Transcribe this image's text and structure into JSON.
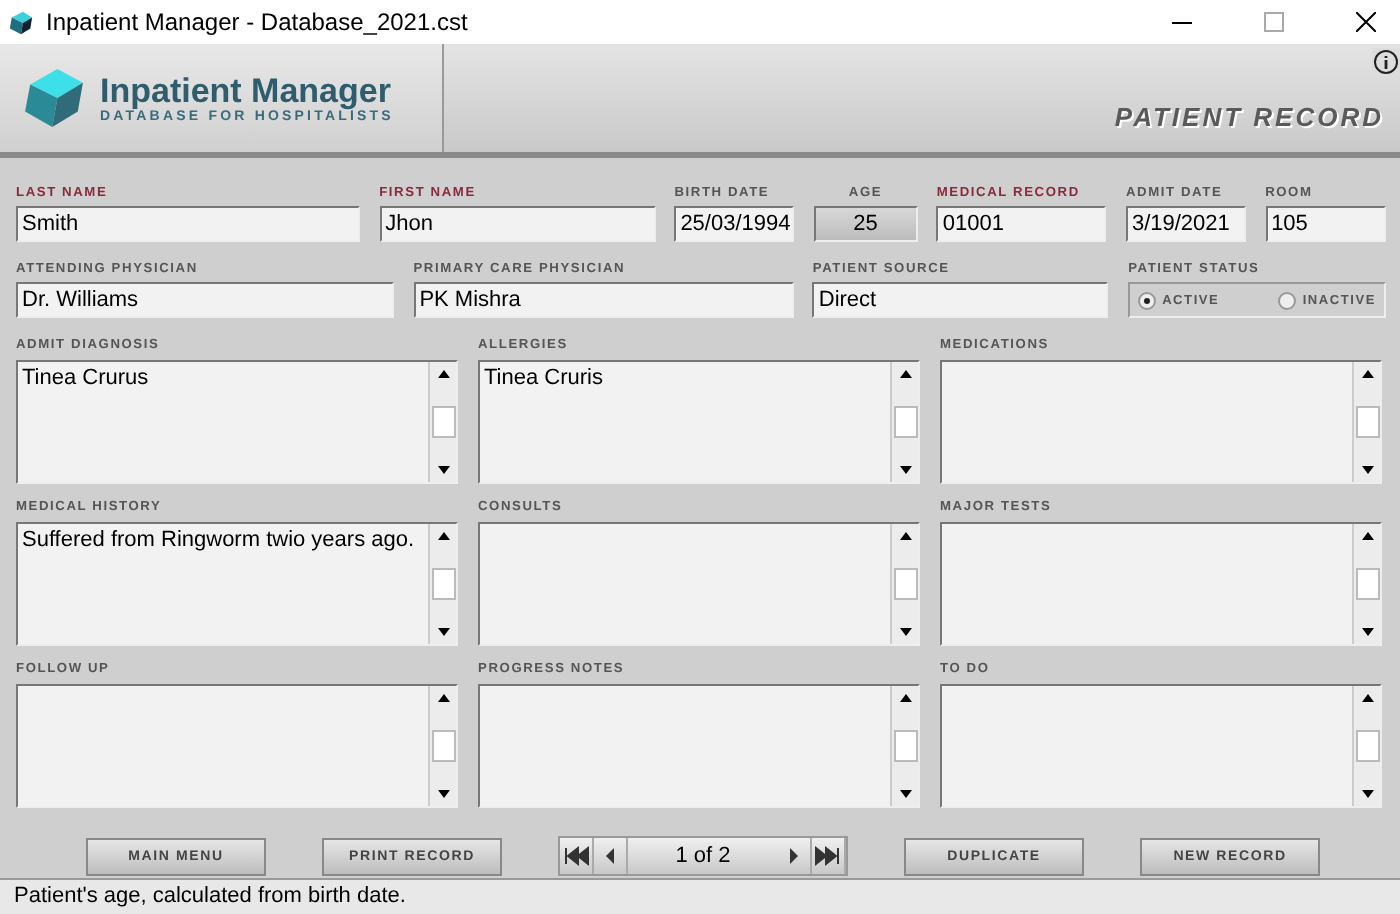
{
  "window": {
    "title": "Inpatient Manager - Database_2021.cst"
  },
  "header": {
    "app_name": "Inpatient Manager",
    "tagline": "DATABASE FOR HOSPITALISTS",
    "section_title": "PATIENT RECORD"
  },
  "row1": [
    {
      "label": "LAST NAME",
      "required": true,
      "value": "Smith",
      "readonly": false
    },
    {
      "label": "FIRST NAME",
      "required": true,
      "value": "Jhon",
      "readonly": false
    },
    {
      "label": "BIRTH DATE",
      "required": false,
      "value": "25/03/1994",
      "readonly": false
    },
    {
      "label": "AGE",
      "required": false,
      "value": "25",
      "readonly": true
    },
    {
      "label": "MEDICAL RECORD",
      "required": true,
      "value": "01001",
      "readonly": false
    },
    {
      "label": "ADMIT DATE",
      "required": false,
      "value": "3/19/2021",
      "readonly": false
    },
    {
      "label": "ROOM",
      "required": false,
      "value": "105",
      "readonly": false
    }
  ],
  "row2": [
    {
      "label": "ATTENDING PHYSICIAN",
      "value": "Dr. Williams"
    },
    {
      "label": "PRIMARY CARE PHYSICIAN",
      "value": "PK Mishra"
    },
    {
      "label": "PATIENT SOURCE",
      "value": "Direct"
    }
  ],
  "patient_status": {
    "label": "PATIENT STATUS",
    "options": [
      {
        "label": "ACTIVE",
        "selected": true
      },
      {
        "label": "INACTIVE",
        "selected": false
      }
    ]
  },
  "notes": [
    {
      "label": "ADMIT DIAGNOSIS",
      "value": "Tinea Crurus"
    },
    {
      "label": "ALLERGIES",
      "value": "Tinea Cruris"
    },
    {
      "label": "MEDICATIONS"
    },
    {
      "label": "MEDICAL HISTORY",
      "value": "Suffered from Ringworm twio years ago."
    },
    {
      "label": "CONSULTS"
    },
    {
      "label": "MAJOR TESTS"
    },
    {
      "label": "FOLLOW UP"
    },
    {
      "label": "PROGRESS NOTES"
    },
    {
      "label": "TO DO"
    }
  ],
  "buttons_left": [
    "MAIN MENU",
    "PRINT RECORD"
  ],
  "pager": {
    "text": "1 of 2"
  },
  "buttons_right": [
    "DUPLICATE",
    "NEW RECORD"
  ],
  "status_bar": "Patient's age, calculated from birth date."
}
